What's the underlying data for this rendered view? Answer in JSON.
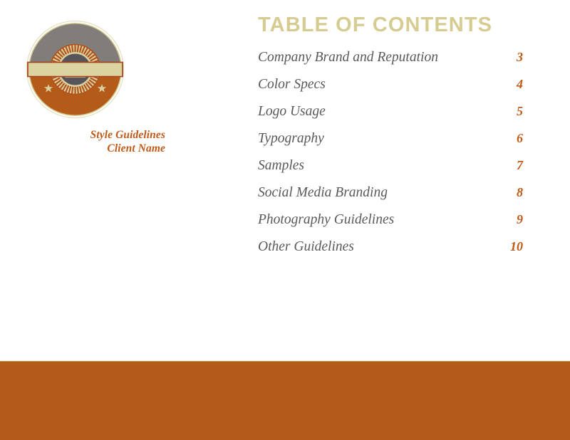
{
  "document": {
    "type": "style-guide-table-of-contents-page"
  },
  "logo": {
    "icon_name": "open-book-badge-logo",
    "emblem_icon": "open-book-icon",
    "star_icon": "star-icon",
    "ribbon_name": "banner-ribbon",
    "colors": {
      "ring_gold": "#D4CB92",
      "top_half_gray": "#807D7A",
      "bottom_half_rust": "#B55B1A",
      "sunburst_rays": "#B0521A",
      "sunburst_base": "#D9CFA0",
      "inner_disc_gray": "#58555A",
      "book_cream": "#EFE6C6",
      "ribbon_fill": "#DCD4A0",
      "ribbon_outline": "#A4451A",
      "star_gold": "#D9CFA0"
    }
  },
  "brand": {
    "line1": "Style Guidelines",
    "line2": "Client Name",
    "color": "#C05A18"
  },
  "toc": {
    "title": "TABLE OF CONTENTS",
    "title_color": "#D6CC91",
    "label_color": "#58595B",
    "page_color": "#C05A18",
    "entries": [
      {
        "label": "Company Brand and Reputation",
        "page": "3"
      },
      {
        "label": "Color Specs",
        "page": "4"
      },
      {
        "label": "Logo Usage",
        "page": "5"
      },
      {
        "label": "Typography",
        "page": "6"
      },
      {
        "label": "Samples",
        "page": "7"
      },
      {
        "label": "Social Media Branding",
        "page": "8"
      },
      {
        "label": "Photography Guidelines",
        "page": "9"
      },
      {
        "label": "Other Guidelines",
        "page": "10"
      }
    ]
  },
  "footer": {
    "band_color": "#B55B1A",
    "rule_color": "#C98F4D"
  }
}
